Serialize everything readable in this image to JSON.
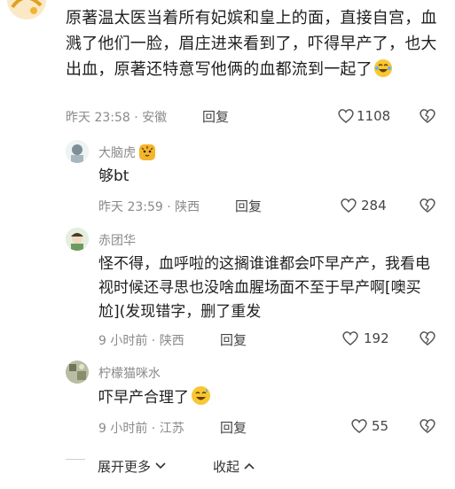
{
  "top_comment": {
    "text": "原著温太医当着所有妃嫔和皇上的面，直接自宫，血溅了他们一脸，眉庄进来看到了，吓得早产了，也大出血，原著还特意写他俩的血都流到一起了",
    "emoji": "crying-laughing-emoji",
    "time": "昨天 23:58 · 安徽",
    "reply_label": "回复",
    "likes": "1108"
  },
  "replies": [
    {
      "username": "大脑虎",
      "badge": "tiger-emoji",
      "text": "够bt",
      "time": "昨天 23:59 · 陕西",
      "reply_label": "回复",
      "likes": "284"
    },
    {
      "username": "赤团华",
      "text": "怪不得，血呼啦的这搁谁谁都会吓早产产，我看电视时候还寻思也没啥血腥场面不至于早产啊[噢买尬](发现错字，删了重发",
      "time": "9 小时前 · 陕西",
      "reply_label": "回复",
      "likes": "192"
    },
    {
      "username": "柠檬猫咪水",
      "text": "吓早产合理了",
      "emoji": "sweat-smile-emoji",
      "time": "9 小时前 · 江苏",
      "reply_label": "回复",
      "likes": "55"
    }
  ],
  "footer": {
    "expand_label": "展开更多",
    "collapse_label": "收起"
  },
  "colors": {
    "text": "#1e1e1e",
    "meta": "#8a8a8a",
    "emoji_yellow": "#f7c734"
  }
}
